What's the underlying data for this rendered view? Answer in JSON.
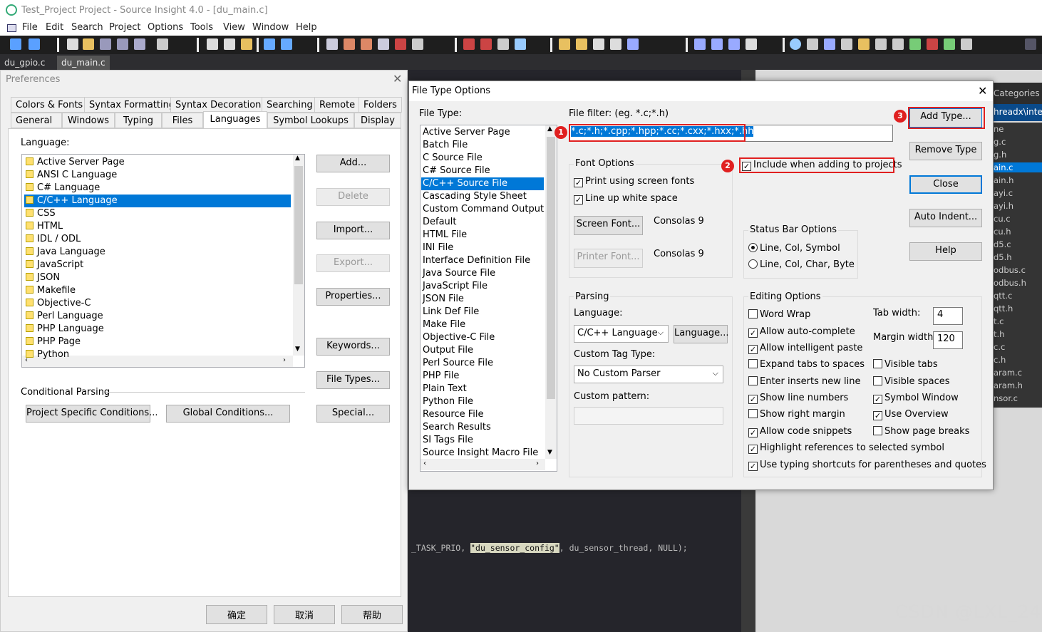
{
  "window": {
    "title": "Test_Project Project - Source Insight 4.0 - [du_main.c]"
  },
  "menu": [
    "File",
    "Edit",
    "Search",
    "Project",
    "Options",
    "Tools",
    "View",
    "Window",
    "Help"
  ],
  "file_tabs": [
    "du_gpio.c",
    "du_main.c"
  ],
  "code_line": {
    "pre": "_TASK_PRIO, ",
    "str": "\"du_sensor_config\"",
    "post": ", du_sensor_thread, NULL);"
  },
  "symbol_panel": {
    "header": "Categories",
    "path": "hreadx\\inter",
    "items": [
      "ne",
      "g.c",
      "g.h",
      "ain.c",
      "ain.h",
      "ayi.c",
      "ayi.h",
      "cu.c",
      "cu.h",
      "d5.c",
      "d5.h",
      "odbus.c",
      "odbus.h",
      "qtt.c",
      "qtt.h",
      "t.c",
      "t.h",
      "c.c",
      "c.h",
      "aram.c",
      "aram.h",
      "nsor.c"
    ],
    "selected": "ain.c"
  },
  "watermark": "CSDN @LXL_24",
  "prefs": {
    "title": "Preferences",
    "tabs_row1": [
      "Colors & Fonts",
      "Syntax Formatting",
      "Syntax Decorations",
      "Searching",
      "Remote",
      "Folders"
    ],
    "tabs_row2": [
      "General",
      "Windows",
      "Typing",
      "Files",
      "Languages",
      "Symbol Lookups",
      "Display"
    ],
    "active_tab": "Languages",
    "language_label": "Language:",
    "languages": [
      "Active Server Page",
      "ANSI C Language",
      "C# Language",
      "C/C++ Language",
      "CSS",
      "HTML",
      "IDL / ODL",
      "Java Language",
      "JavaScript",
      "JSON",
      "Makefile",
      "Objective-C",
      "Perl Language",
      "PHP Language",
      "PHP Page",
      "Python"
    ],
    "selected_language": "C/C++ Language",
    "buttons": {
      "add": "Add...",
      "delete": "Delete",
      "import": "Import...",
      "export": "Export...",
      "properties": "Properties...",
      "keywords": "Keywords...",
      "file_types": "File Types...",
      "special": "Special..."
    },
    "conditional_parsing": "Conditional Parsing",
    "project_conditions": "Project Specific Conditions...",
    "global_conditions": "Global Conditions...",
    "ok": "确定",
    "cancel": "取消",
    "help": "帮助"
  },
  "ftdlg": {
    "title": "File Type Options",
    "file_type_label": "File Type:",
    "file_types": [
      "Active Server Page",
      "Batch File",
      "C Source File",
      "C# Source File",
      "C/C++ Source File",
      "Cascading Style Sheet",
      "Custom Command Output",
      "Default",
      "HTML File",
      "INI File",
      "Interface Definition File",
      "Java Source File",
      "JavaScript File",
      "JSON File",
      "Link Def File",
      "Make File",
      "Objective-C File",
      "Output File",
      "Perl Source File",
      "PHP File",
      "Plain Text",
      "Python File",
      "Resource File",
      "Search Results",
      "SI Tags File",
      "Source Insight Macro File"
    ],
    "selected_type": "C/C++ Source File",
    "file_filter_label": "File filter: (eg. *.c;*.h)",
    "file_filter_value": "*.c;*.h;*.cpp;*.hpp;*.cc;*.cxx;*.hxx;*.hh",
    "include_in_projects": {
      "label": "Include when adding to projects",
      "checked": true
    },
    "font_options": {
      "title": "Font Options",
      "print_screen_fonts": "Print using screen fonts",
      "line_up_ws": "Line up white space",
      "screen_font_btn": "Screen Font...",
      "screen_font": "Consolas 9",
      "printer_font_btn": "Printer Font...",
      "printer_font": "Consolas 9"
    },
    "status_bar": {
      "title": "Status Bar Options",
      "opt1": "Line, Col, Symbol",
      "opt2": "Line, Col, Char, Byte",
      "selected": "Line, Col, Symbol"
    },
    "parsing": {
      "title": "Parsing",
      "language_label": "Language:",
      "language": "C/C++ Language",
      "language_btn": "Language...",
      "tag_type_label": "Custom Tag Type:",
      "tag_type": "No Custom Parser",
      "pattern_label": "Custom pattern:",
      "pattern": ""
    },
    "editing": {
      "title": "Editing Options",
      "word_wrap": {
        "label": "Word Wrap",
        "checked": false
      },
      "auto_complete": {
        "label": "Allow auto-complete",
        "checked": true
      },
      "intelligent_paste": {
        "label": "Allow intelligent paste",
        "checked": true
      },
      "expand_tabs": {
        "label": "Expand tabs to spaces",
        "checked": false
      },
      "enter_inserts": {
        "label": "Enter inserts new line",
        "checked": false
      },
      "line_numbers": {
        "label": "Show line numbers",
        "checked": true
      },
      "right_margin": {
        "label": "Show right margin",
        "checked": false
      },
      "code_snippets": {
        "label": "Allow code snippets",
        "checked": true
      },
      "highlight_refs": {
        "label": "Highlight references to selected symbol",
        "checked": true
      },
      "typing_shortcuts": {
        "label": "Use typing shortcuts for parentheses and quotes",
        "checked": true
      },
      "visible_tabs": {
        "label": "Visible tabs",
        "checked": false
      },
      "visible_spaces": {
        "label": "Visible spaces",
        "checked": false
      },
      "symbol_window": {
        "label": "Symbol Window",
        "checked": true
      },
      "use_overview": {
        "label": "Use Overview",
        "checked": true
      },
      "page_breaks": {
        "label": "Show page breaks",
        "checked": false
      },
      "tab_width_label": "Tab width:",
      "tab_width": "4",
      "margin_width_label": "Margin width:",
      "margin_width": "120"
    },
    "buttons": {
      "add_type": "Add Type...",
      "remove_type": "Remove Type",
      "close": "Close",
      "auto_indent": "Auto Indent...",
      "help": "Help"
    },
    "annotations": [
      "1",
      "2",
      "3"
    ],
    "annotation_color": "#e02020"
  }
}
